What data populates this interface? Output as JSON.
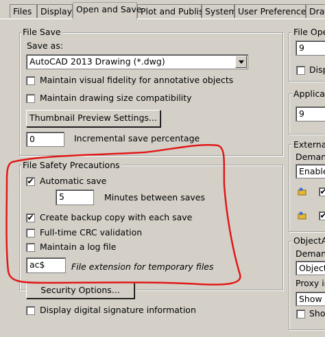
{
  "tabs": [
    {
      "label": "Files"
    },
    {
      "label": "Display"
    },
    {
      "label": "Open and Save"
    },
    {
      "label": "Plot and Publish"
    },
    {
      "label": "System"
    },
    {
      "label": "User Preferences"
    },
    {
      "label": "Draft"
    }
  ],
  "file_save": {
    "title": "File Save",
    "save_as_label": "Save as:",
    "save_as_value": "AutoCAD 2013 Drawing (*.dwg)",
    "visual_fidelity": "Maintain visual fidelity for annotative objects",
    "drawing_size": "Maintain drawing size compatibility",
    "thumbnail_button": "Thumbnail Preview Settings...",
    "incremental_value": "0",
    "incremental_label": "Incremental save percentage"
  },
  "file_safety": {
    "title": "File Safety Precautions",
    "automatic_save": "Automatic save",
    "minutes_value": "5",
    "minutes_label": "Minutes between saves",
    "backup_copy": "Create backup copy with each save",
    "crc": "Full-time CRC validation",
    "log_file": "Maintain a log file",
    "ext_value": "ac$",
    "ext_label": "File extension for temporary files",
    "security_button": "Security Options...",
    "digital_signature": "Display digital signature information"
  },
  "right": {
    "file_open_title": "File Ope",
    "file_open_value": "9",
    "disp_label": "Disp",
    "application_title": "Applicatio",
    "application_value": "9",
    "external_title": "External",
    "demand_label": "Demane",
    "enable_value": "Enable",
    "objectarx_title": "ObjectAR",
    "demand2_label": "Demano",
    "object_value": "Object",
    "proxy_label": "Proxy in",
    "show_value": "Show p",
    "show_label": "Sho"
  },
  "colors": {
    "annotation": "#e01818",
    "background": "#d4d0c8"
  }
}
